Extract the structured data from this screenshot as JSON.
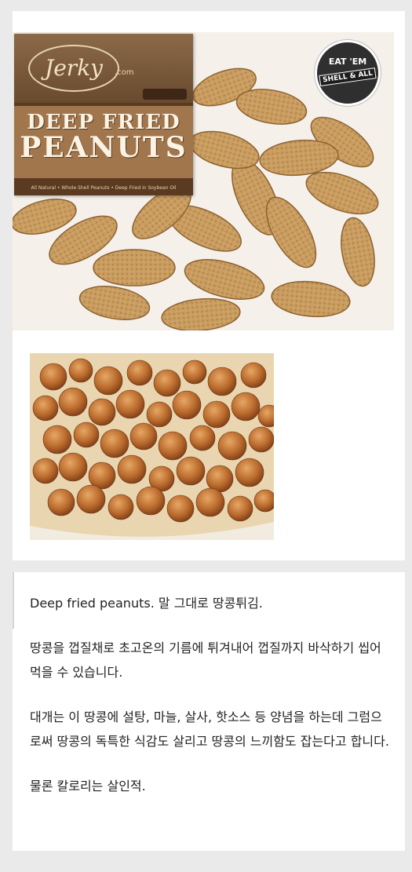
{
  "images": {
    "peanuts_photo": {
      "brand_logo": "Jerky",
      "brand_domain": ".com",
      "product_line1": "DEEP FRIED",
      "product_line2": "PEANUTS",
      "tagline": "All Natural • Whole Shell Peanuts • Deep Fried in Soybean Oil",
      "badge_line1": "EAT 'EM",
      "badge_line2": "SHELL & ALL"
    }
  },
  "post": {
    "paragraphs": [
      "Deep fried peanuts. 말 그대로 땅콩튀김.",
      "땅콩을 껍질채로 초고온의 기름에 튀겨내어 껍질까지 바삭하기 씹어먹을 수 있습니다.",
      "대개는 이 땅콩에 설탕, 마늘, 살사, 핫소스 등 양념을 하는데 그럼으로써 땅콩의 독특한 식감도 살리고 땅콩의 느끼함도 잡는다고 합니다.",
      "물론 칼로리는 살인적."
    ]
  },
  "colors": {
    "background": "#eaeaea",
    "card": "#ffffff",
    "text": "#222222",
    "peanut_shell": "#c79a5e",
    "fried_peanut": "#b8692c"
  }
}
